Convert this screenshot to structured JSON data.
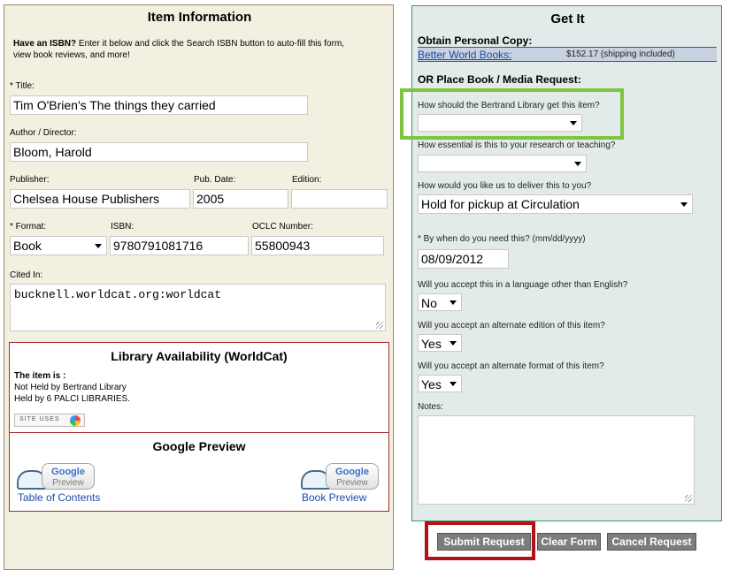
{
  "item_info": {
    "title": "Item Information",
    "isbn_hint_bold": "Have an ISBN?",
    "isbn_hint_rest": " Enter it below and click the Search ISBN button to auto-fill this form,",
    "isbn_hint_line2": "view book reviews, and more!",
    "title_label": "* Title:",
    "title_value": "Tim O'Brien's The things they carried",
    "author_label": "Author / Director:",
    "author_value": "Bloom, Harold",
    "publisher_label": "Publisher:",
    "publisher_value": "Chelsea House Publishers",
    "pubdate_label": "Pub. Date:",
    "pubdate_value": "2005",
    "edition_label": "Edition:",
    "edition_value": "",
    "format_label": "* Format:",
    "format_value": "Book",
    "isbn_label": "ISBN:",
    "isbn_value": "9780791081716",
    "oclc_label": "OCLC Number:",
    "oclc_value": "55800943",
    "cited_label": "Cited In:",
    "cited_value": "bucknell.worldcat.org:worldcat"
  },
  "availability": {
    "title": "Library Availability (WorldCat)",
    "item_is": "The item is :",
    "line1": "Not Held by Bertrand Library",
    "line2": "Held by 6 PALCI LIBRARIES.",
    "site_uses": "SITE USES"
  },
  "google": {
    "title": "Google Preview",
    "badge_top": "Google",
    "badge_bottom": "Preview",
    "toc_link": "Table of Contents",
    "preview_link": "Book Preview"
  },
  "get_it": {
    "title": "Get It",
    "personal_copy_label": "Obtain Personal Copy:",
    "vendor_link": "Better World Books:",
    "vendor_price": "$152.17 (shipping included)",
    "request_label": "OR Place Book / Media Request:",
    "q_how_get": "How should the Bertrand Library get this item?",
    "how_get_value": "",
    "q_essential": "How essential is this to your research or teaching?",
    "essential_value": "",
    "q_deliver": "How would you like us to deliver this to you?",
    "deliver_value": "Hold for pickup at Circulation",
    "q_when": "* By when do you need this? (mm/dd/yyyy)",
    "when_value": "08/09/2012",
    "q_language": "Will you accept this in a language other than English?",
    "language_value": "No",
    "q_edition": "Will you accept an alternate edition of this item?",
    "edition_value": "Yes",
    "q_format": "Will you accept an alternate format of this item?",
    "format_value": "Yes",
    "notes_label": "Notes:",
    "notes_value": ""
  },
  "buttons": {
    "submit": "Submit Request",
    "clear": "Clear Form",
    "cancel": "Cancel Request"
  },
  "colors": {
    "highlight_green": "#7ec440",
    "highlight_red": "#b01217"
  }
}
